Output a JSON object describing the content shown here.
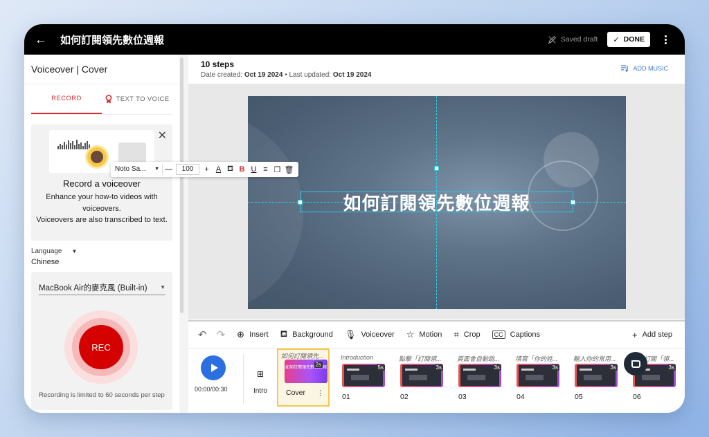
{
  "window": {
    "title": "如何訂閱領先數位週報",
    "saved_status": "Saved draft",
    "done_label": "DONE"
  },
  "left_panel": {
    "heading": "Voiceover | Cover",
    "tabs": [
      {
        "label": "RECORD",
        "active": true
      },
      {
        "label": "TEXT TO VOICE",
        "active": false
      }
    ],
    "promo": {
      "title": "Record a voiceover",
      "line1": "Enhance your how-to videos with voiceovers.",
      "line2": "Voiceovers are also transcribed to text."
    },
    "language_label": "Language",
    "language_value": "Chinese",
    "mic_device": "MacBook Air的麥克風 (Built-in)",
    "rec_label": "REC",
    "rec_note": "Recording is limited to 60 seconds per step"
  },
  "main": {
    "steps_count": "10 steps",
    "date_created_label": "Date created: ",
    "date_created": "Oct 19 2024",
    "last_updated_label": " • Last updated: ",
    "last_updated": "Oct 19 2024",
    "add_music": "ADD MUSIC",
    "slide_title": "如何訂閱領先數位週報"
  },
  "format_toolbar": {
    "font": "Noto Sa...",
    "size": "100"
  },
  "toolbar": {
    "insert": "Insert",
    "background": "Background",
    "voiceover": "Voiceover",
    "motion": "Motion",
    "crop": "Crop",
    "captions": "Captions",
    "add_step": "Add step"
  },
  "timeline": {
    "timecode": "00:00/00:30",
    "intro_label": "Intro",
    "steps": [
      {
        "caption": "如何訂閱領先...",
        "duration": "2s",
        "label": "Cover",
        "thumb_title": "如何訂閱領先數位週報"
      },
      {
        "caption": "Introduction",
        "duration": "5s",
        "label": "01"
      },
      {
        "caption": "點擊「訂閱領...",
        "duration": "3s",
        "label": "02"
      },
      {
        "caption": "頁面會自動跳...",
        "duration": "3s",
        "label": "03"
      },
      {
        "caption": "填寫「你的姓...",
        "duration": "3s",
        "label": "04"
      },
      {
        "caption": "輸入你的常用...",
        "duration": "3s",
        "label": "05"
      },
      {
        "caption": "勾選訂閱「領...",
        "duration": "3s",
        "label": "06"
      }
    ]
  },
  "colors": {
    "accent_red": "#d32f2f",
    "play_blue": "#2b6fe0",
    "guide_cyan": "#22d3ee",
    "cover_highlight": "#f5c84c"
  }
}
